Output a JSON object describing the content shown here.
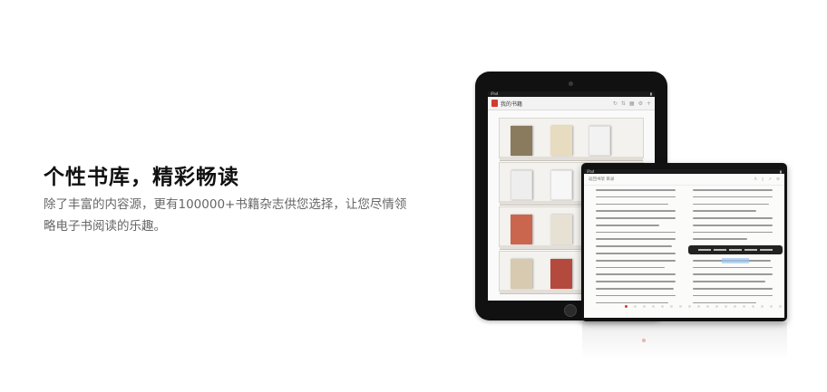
{
  "promo": {
    "title": "个性书库，精彩畅读",
    "description": "除了丰富的内容源，更有100000+书籍杂志供您选择，让您尽情领略电子书阅读的乐趣。"
  },
  "bookshelf_device": {
    "status_left": "iPad",
    "header_title": "我的书籍",
    "header_icons": [
      "refresh-icon",
      "sort-icon",
      "grid-icon",
      "settings-icon",
      "add-icon"
    ]
  },
  "reader_device": {
    "status_left": "iPad",
    "toolbar_left": "返回书架   目录",
    "toolbar_icons": [
      "font-icon",
      "bookmark-icon",
      "share-icon",
      "settings-icon"
    ]
  },
  "colors": {
    "accent": "#d43a2f",
    "device_frame": "#111111",
    "title_text": "#111111",
    "body_text": "#666666"
  }
}
